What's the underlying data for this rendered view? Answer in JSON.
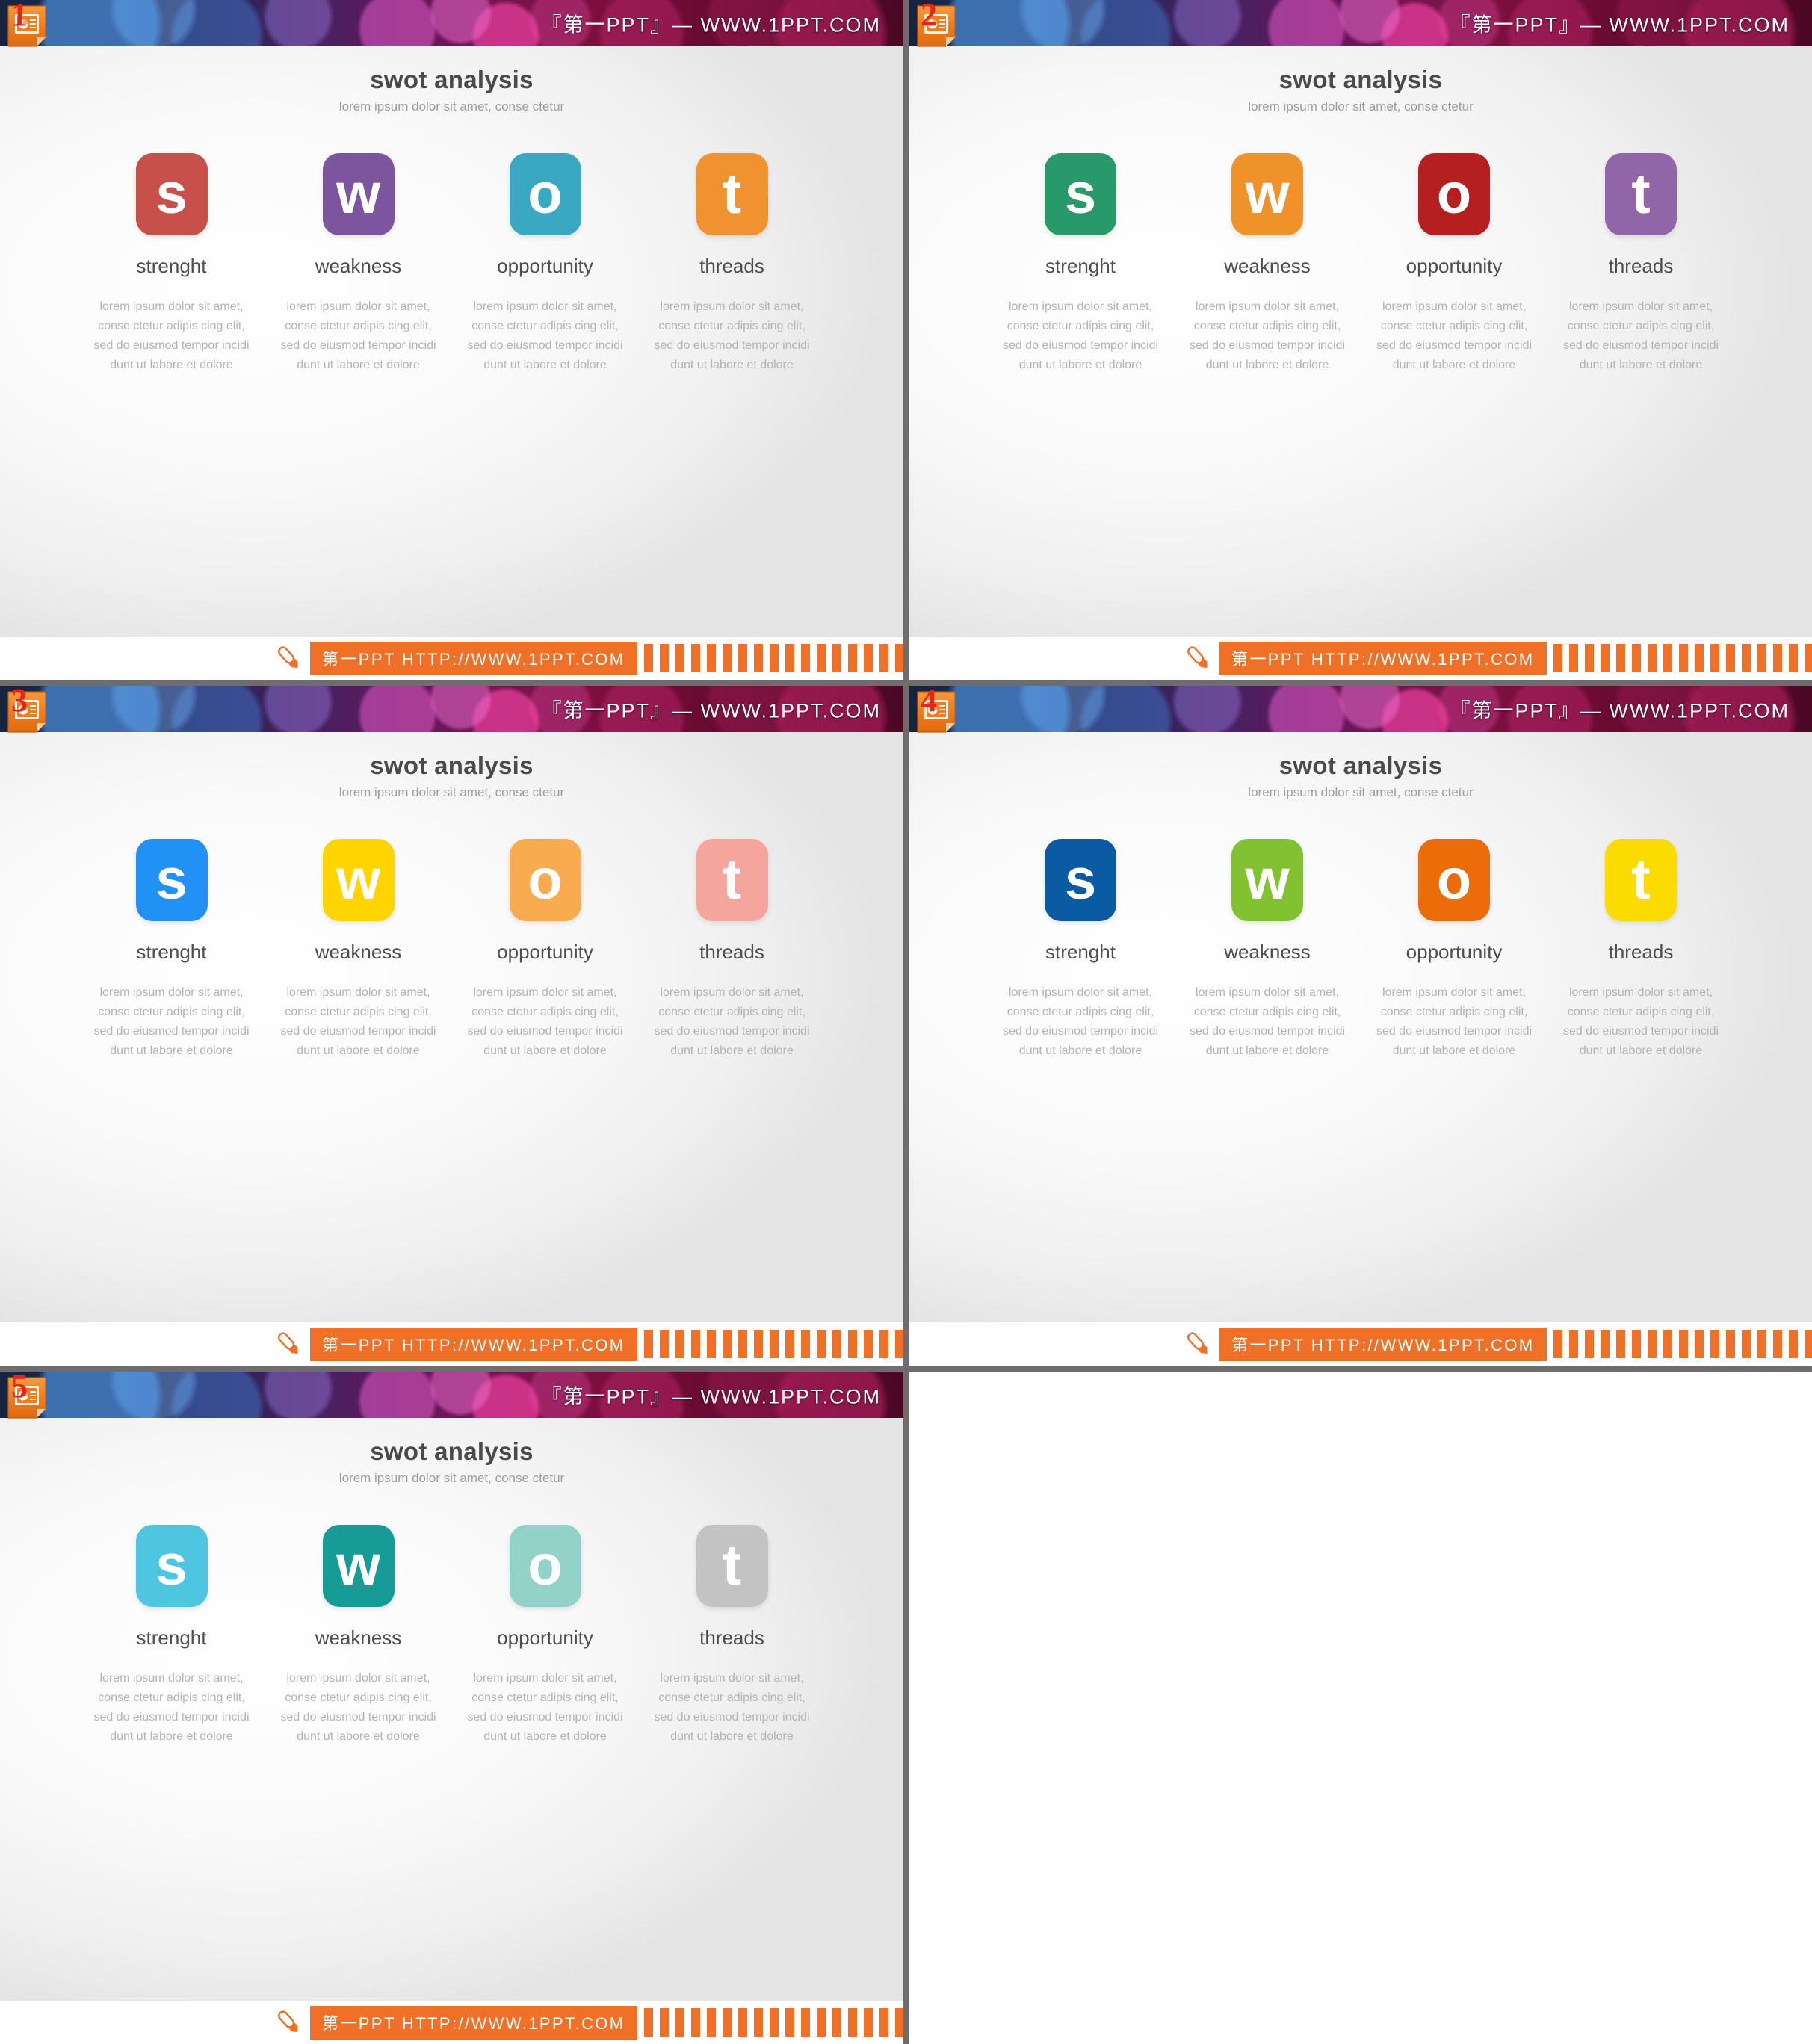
{
  "banner": {
    "title": "『第一PPT』— WWW.1PPT.COM"
  },
  "footer": {
    "url": "第一PPT HTTP://WWW.1PPT.COM",
    "pencil_icon": "pencil-icon",
    "stripes": "stripe-decoration"
  },
  "heading": {
    "title": "swot analysis",
    "subtitle": "lorem ipsum dolor sit amet, conse ctetur"
  },
  "columns": [
    {
      "letter": "s",
      "label": "strenght",
      "desc": "lorem ipsum dolor sit amet, conse ctetur adipis cing elit, sed do eiusmod tempor incidi dunt ut labore et dolore"
    },
    {
      "letter": "w",
      "label": "weakness",
      "desc": "lorem ipsum dolor sit amet, conse ctetur adipis cing elit, sed do eiusmod tempor incidi dunt ut labore et dolore"
    },
    {
      "letter": "o",
      "label": "opportunity",
      "desc": "lorem ipsum dolor sit amet, conse ctetur adipis cing elit, sed do eiusmod tempor incidi dunt ut labore et dolore"
    },
    {
      "letter": "t",
      "label": "threads",
      "desc": "lorem ipsum dolor sit amet, conse ctetur adipis cing elit, sed do eiusmod tempor incidi dunt ut labore et dolore"
    }
  ],
  "slides": [
    {
      "badge": "1",
      "tile_colors": [
        "#c8504a",
        "#7d559e",
        "#3aa8c1",
        "#f0922f"
      ]
    },
    {
      "badge": "2",
      "tile_colors": [
        "#27996b",
        "#ef9229",
        "#b51f1f",
        "#9166a8"
      ]
    },
    {
      "badge": "3",
      "tile_colors": [
        "#2191f5",
        "#ffd400",
        "#f9ab50",
        "#f5a69c"
      ]
    },
    {
      "badge": "4",
      "tile_colors": [
        "#0b5aa4",
        "#82c130",
        "#ec6c09",
        "#fcdb00"
      ]
    },
    {
      "badge": "5",
      "tile_colors": [
        "#4ec6e2",
        "#179b96",
        "#93d2c8",
        "#c3c3c3"
      ]
    }
  ],
  "accent_color": "#ef7026",
  "separator_color": "#6e6c6c"
}
